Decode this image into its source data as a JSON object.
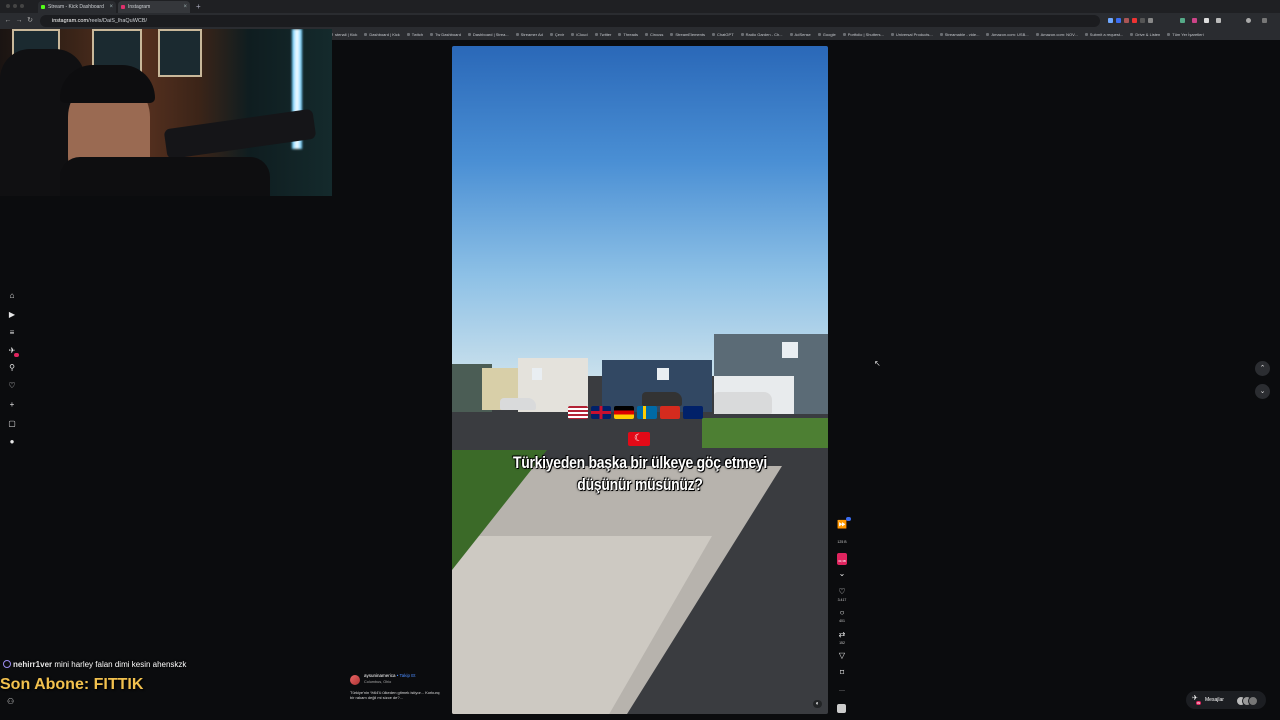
{
  "browser": {
    "tabs": [
      {
        "label": "Stream - Kick Dashboard",
        "color": "#53fc18"
      },
      {
        "label": "Instagram",
        "color": "#e1306c"
      }
    ],
    "url_host": "instagram.com",
    "url_path": "/reels/DaiS_lhaQuWCB/",
    "bookmarks": [
      "stenali | Kick",
      "Dashboard | Kick",
      "Twitch",
      "Tw Dashboard",
      "Dashboard | Strea...",
      "Streamer Ad",
      "Çevir",
      "iCloud",
      "Twitter",
      "Threads",
      "Circuss",
      "StreamElements",
      "ChatGPT",
      "Radio Garden - Ch...",
      "AdSense",
      "Google",
      "Portfolio | Shutters...",
      "Universal Products...",
      "Streamable - vide...",
      "Amazon.com: USB...",
      "Amazon.com: NOV...",
      "Submit a request...",
      "Drive & Listen",
      "Tüm Yer İşaretleri"
    ]
  },
  "overlay": {
    "chat_user": "nehirr1ver",
    "chat_message": "mini harley falan dimi kesin ahenskzk",
    "last_sub": "Son Abone: FITTIK"
  },
  "reel": {
    "caption": "Türkiyeden başka bir ülkeye göç etmeyi düşünür müsünüz?",
    "author": "aysuninamerica",
    "follow": "• Takip Et",
    "location": "Columbus, Ohio",
    "description": "Türkiye'nin %64'ü ülkeden gitmek istiyor... Korkunç bir rakam değil mi sizce de?...",
    "flags": [
      "us-flag",
      "uk-flag",
      "germany-flag",
      "sweden-flag",
      "switzerland-flag",
      "australia-flag"
    ]
  },
  "actions": {
    "views": "125 B",
    "remix_badge": "33,3B",
    "likes": "3.417",
    "comments": "401",
    "reposts": "152"
  },
  "messages": {
    "label": "Mesajlar",
    "badge": "99"
  },
  "colors": {
    "accent_kick": "#53fc18",
    "instagram": "#e1306c",
    "sub_gold": "#f2c14e",
    "follow_blue": "#4c8dff"
  }
}
